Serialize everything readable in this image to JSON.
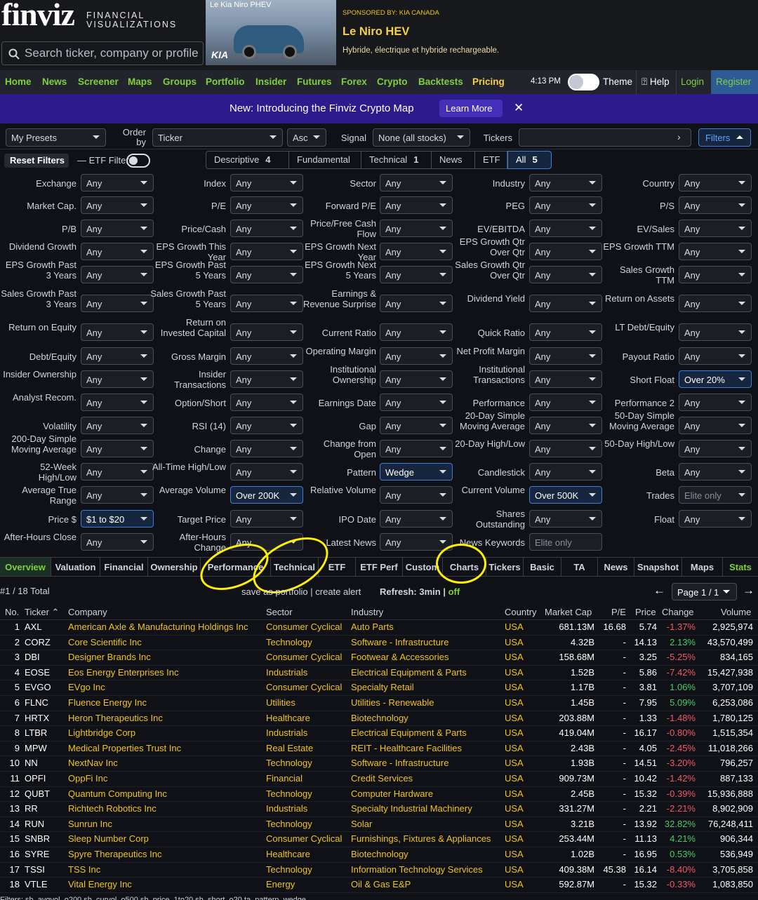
{
  "header": {
    "logo": "finviz",
    "logo_sub1": "FINANCIAL",
    "logo_sub2": "VISUALIZATIONS",
    "search_placeholder": "Search ticker, company or profile",
    "ad": {
      "image_text": "Le Kia Niro PHEV",
      "brand": "KIA",
      "sponsor": "SPONSORED BY: KIA CANADA",
      "title": "Le Niro HEV",
      "subtitle": "Hybride, électrique et hybride rechargeable."
    }
  },
  "nav": {
    "items": [
      "Home",
      "News",
      "Screener",
      "Maps",
      "Groups",
      "Portfolio",
      "Insider",
      "Futures",
      "Forex",
      "Crypto",
      "Backtests",
      "Pricing"
    ],
    "time": "4:13 PM",
    "theme": "Theme",
    "help": "Help",
    "login": "Login",
    "register": "Register"
  },
  "banner": {
    "text": "New: Introducing the Finviz Crypto Map",
    "button": "Learn More",
    "close": "✕"
  },
  "controls": {
    "presets": "My Presets",
    "order_by_label": "Order by",
    "order_by": "Ticker",
    "order_dir": "Asc",
    "signal_label": "Signal",
    "signal": "None (all stocks)",
    "tickers_label": "Tickers",
    "tickers_value": "",
    "filters_button": "Filters"
  },
  "filter_bar": {
    "reset": "Reset Filters",
    "etf_filters": "ETF Filters",
    "tabs": [
      {
        "label": "Descriptive",
        "count": "4"
      },
      {
        "label": "Fundamental",
        "count": ""
      },
      {
        "label": "Technical",
        "count": "1"
      },
      {
        "label": "News",
        "count": ""
      },
      {
        "label": "ETF",
        "count": ""
      },
      {
        "label": "All",
        "count": "5"
      }
    ]
  },
  "filters": [
    [
      "Exchange",
      "Any"
    ],
    [
      "Index",
      "Any"
    ],
    [
      "Sector",
      "Any"
    ],
    [
      "Industry",
      "Any"
    ],
    [
      "Country",
      "Any"
    ],
    [
      "Market Cap.",
      "Any"
    ],
    [
      "P/E",
      "Any"
    ],
    [
      "Forward P/E",
      "Any"
    ],
    [
      "PEG",
      "Any"
    ],
    [
      "P/S",
      "Any"
    ],
    [
      "P/B",
      "Any"
    ],
    [
      "Price/Cash",
      "Any"
    ],
    [
      "Price/Free Cash Flow",
      "Any"
    ],
    [
      "EV/EBITDA",
      "Any"
    ],
    [
      "EV/Sales",
      "Any"
    ],
    [
      "Dividend Growth",
      "Any"
    ],
    [
      "EPS Growth This Year",
      "Any"
    ],
    [
      "EPS Growth Next Year",
      "Any"
    ],
    [
      "EPS Growth Qtr Over Qtr",
      "Any"
    ],
    [
      "EPS Growth TTM",
      "Any"
    ],
    [
      "EPS Growth Past 3 Years",
      "Any"
    ],
    [
      "EPS Growth Past 5 Years",
      "Any"
    ],
    [
      "EPS Growth Next 5 Years",
      "Any"
    ],
    [
      "Sales Growth Qtr Over Qtr",
      "Any"
    ],
    [
      "Sales Growth TTM",
      "Any"
    ],
    [
      "Sales Growth Past 3 Years",
      "Any"
    ],
    [
      "Sales Growth Past 5 Years",
      "Any"
    ],
    [
      "Earnings & Revenue Surprise",
      "Any"
    ],
    [
      "Dividend Yield",
      "Any"
    ],
    [
      "Return on Assets",
      "Any"
    ],
    [
      "Return on Equity",
      "Any"
    ],
    [
      "Return on Invested Capital",
      "Any"
    ],
    [
      "Current Ratio",
      "Any"
    ],
    [
      "Quick Ratio",
      "Any"
    ],
    [
      "LT Debt/Equity",
      "Any"
    ],
    [
      "Debt/Equity",
      "Any"
    ],
    [
      "Gross Margin",
      "Any"
    ],
    [
      "Operating Margin",
      "Any"
    ],
    [
      "Net Profit Margin",
      "Any"
    ],
    [
      "Payout Ratio",
      "Any"
    ],
    [
      "Insider Ownership",
      "Any"
    ],
    [
      "Insider Transactions",
      "Any"
    ],
    [
      "Institutional Ownership",
      "Any"
    ],
    [
      "Institutional Transactions",
      "Any"
    ],
    [
      "Short Float",
      "Over 20%"
    ],
    [
      "Analyst Recom.",
      "Any"
    ],
    [
      "Option/Short",
      "Any"
    ],
    [
      "Earnings Date",
      "Any"
    ],
    [
      "Performance",
      "Any"
    ],
    [
      "Performance 2",
      "Any"
    ],
    [
      "Volatility",
      "Any"
    ],
    [
      "RSI (14)",
      "Any"
    ],
    [
      "Gap",
      "Any"
    ],
    [
      "20-Day Simple Moving Average",
      "Any"
    ],
    [
      "50-Day Simple Moving Average",
      "Any"
    ],
    [
      "200-Day Simple Moving Average",
      "Any"
    ],
    [
      "Change",
      "Any"
    ],
    [
      "Change from Open",
      "Any"
    ],
    [
      "20-Day High/Low",
      "Any"
    ],
    [
      "50-Day High/Low",
      "Any"
    ],
    [
      "52-Week High/Low",
      "Any"
    ],
    [
      "All-Time High/Low",
      "Any"
    ],
    [
      "Pattern",
      "Wedge"
    ],
    [
      "Candlestick",
      "Any"
    ],
    [
      "Beta",
      "Any"
    ],
    [
      "Average True Range",
      "Any"
    ],
    [
      "Average Volume",
      "Over 200K"
    ],
    [
      "Relative Volume",
      "Any"
    ],
    [
      "Current Volume",
      "Over 500K"
    ],
    [
      "Trades",
      "Elite only"
    ],
    [
      "Price $",
      "$1 to $20"
    ],
    [
      "Target Price",
      "Any"
    ],
    [
      "IPO Date",
      "Any"
    ],
    [
      "Shares Outstanding",
      "Any"
    ],
    [
      "Float",
      "Any"
    ],
    [
      "After-Hours Close",
      "Any"
    ],
    [
      "After-Hours Change",
      "Any"
    ],
    [
      "Latest News",
      "Any"
    ],
    [
      "News Keywords",
      "Elite only"
    ]
  ],
  "view_tabs": [
    "Overview",
    "Valuation",
    "Financial",
    "Ownership",
    "Performance",
    "Technical",
    "ETF",
    "ETF Perf",
    "Custom",
    "Charts",
    "Tickers",
    "Basic",
    "TA",
    "News",
    "Snapshot",
    "Maps",
    "Stats"
  ],
  "results": {
    "total": "#1 / 18 Total",
    "save_as": "save as portfolio | create alert",
    "refresh_label": "Refresh:",
    "refresh_value": "3min",
    "refresh_sep": "|",
    "refresh_off": "off",
    "page": "Page 1 / 1",
    "prev": "←",
    "next": "→"
  },
  "table": {
    "headers": [
      "No.",
      "Ticker",
      "Company",
      "Sector",
      "Industry",
      "Country",
      "Market Cap",
      "P/E",
      "Price",
      "Change",
      "Volume"
    ],
    "rows": [
      [
        "1",
        "AXL",
        "American Axle & Manufacturing Holdings Inc",
        "Consumer Cyclical",
        "Auto Parts",
        "USA",
        "681.13M",
        "16.68",
        "5.74",
        "-1.37%",
        "2,925,974"
      ],
      [
        "2",
        "CORZ",
        "Core Scientific Inc",
        "Technology",
        "Software - Infrastructure",
        "USA",
        "4.32B",
        "-",
        "14.13",
        "2.13%",
        "43,570,499"
      ],
      [
        "3",
        "DBI",
        "Designer Brands Inc",
        "Consumer Cyclical",
        "Footwear & Accessories",
        "USA",
        "158.68M",
        "-",
        "3.25",
        "-5.25%",
        "834,165"
      ],
      [
        "4",
        "EOSE",
        "Eos Energy Enterprises Inc",
        "Industrials",
        "Electrical Equipment & Parts",
        "USA",
        "1.52B",
        "-",
        "5.86",
        "-7.42%",
        "15,427,938"
      ],
      [
        "5",
        "EVGO",
        "EVgo Inc",
        "Consumer Cyclical",
        "Specialty Retail",
        "USA",
        "1.17B",
        "-",
        "3.81",
        "1.06%",
        "3,707,109"
      ],
      [
        "6",
        "FLNC",
        "Fluence Energy Inc",
        "Utilities",
        "Utilities - Renewable",
        "USA",
        "1.45B",
        "-",
        "7.95",
        "5.09%",
        "6,253,086"
      ],
      [
        "7",
        "HRTX",
        "Heron Therapeutics Inc",
        "Healthcare",
        "Biotechnology",
        "USA",
        "203.88M",
        "-",
        "1.33",
        "-1.48%",
        "1,780,125"
      ],
      [
        "8",
        "LTBR",
        "Lightbridge Corp",
        "Industrials",
        "Electrical Equipment & Parts",
        "USA",
        "419.04M",
        "-",
        "16.17",
        "-0.80%",
        "1,515,354"
      ],
      [
        "9",
        "MPW",
        "Medical Properties Trust Inc",
        "Real Estate",
        "REIT - Healthcare Facilities",
        "USA",
        "2.43B",
        "-",
        "4.05",
        "-2.45%",
        "11,018,266"
      ],
      [
        "10",
        "NN",
        "NextNav Inc",
        "Technology",
        "Software - Infrastructure",
        "USA",
        "1.93B",
        "-",
        "14.51",
        "-3.20%",
        "796,257"
      ],
      [
        "11",
        "OPFI",
        "OppFi Inc",
        "Financial",
        "Credit Services",
        "USA",
        "909.73M",
        "-",
        "10.42",
        "-1.42%",
        "887,133"
      ],
      [
        "12",
        "QUBT",
        "Quantum Computing Inc",
        "Technology",
        "Computer Hardware",
        "USA",
        "2.45B",
        "-",
        "15.32",
        "-0.39%",
        "15,936,888"
      ],
      [
        "13",
        "RR",
        "Richtech Robotics Inc",
        "Industrials",
        "Specialty Industrial Machinery",
        "USA",
        "331.27M",
        "-",
        "2.21",
        "-2.21%",
        "8,902,909"
      ],
      [
        "14",
        "RUN",
        "Sunrun Inc",
        "Technology",
        "Solar",
        "USA",
        "3.21B",
        "-",
        "13.92",
        "32.82%",
        "76,248,411"
      ],
      [
        "15",
        "SNBR",
        "Sleep Number Corp",
        "Consumer Cyclical",
        "Furnishings, Fixtures & Appliances",
        "USA",
        "253.44M",
        "-",
        "11.13",
        "4.21%",
        "906,344"
      ],
      [
        "16",
        "SYRE",
        "Spyre Therapeutics Inc",
        "Healthcare",
        "Biotechnology",
        "USA",
        "1.02B",
        "-",
        "16.95",
        "0.53%",
        "536,949"
      ],
      [
        "17",
        "TSSI",
        "TSS Inc",
        "Technology",
        "Information Technology Services",
        "USA",
        "409.38M",
        "45.38",
        "16.14",
        "-8.40%",
        "3,705,858"
      ],
      [
        "18",
        "VTLE",
        "Vital Energy Inc",
        "Energy",
        "Oil & Gas E&P",
        "USA",
        "592.87M",
        "-",
        "15.32",
        "-0.33%",
        "1,083,850"
      ]
    ]
  },
  "footer": "Filters: sh_avgvol_o200 sh_curvol_o500 sh_price_1to20 sh_short_o20 ta_pattern_wedge"
}
